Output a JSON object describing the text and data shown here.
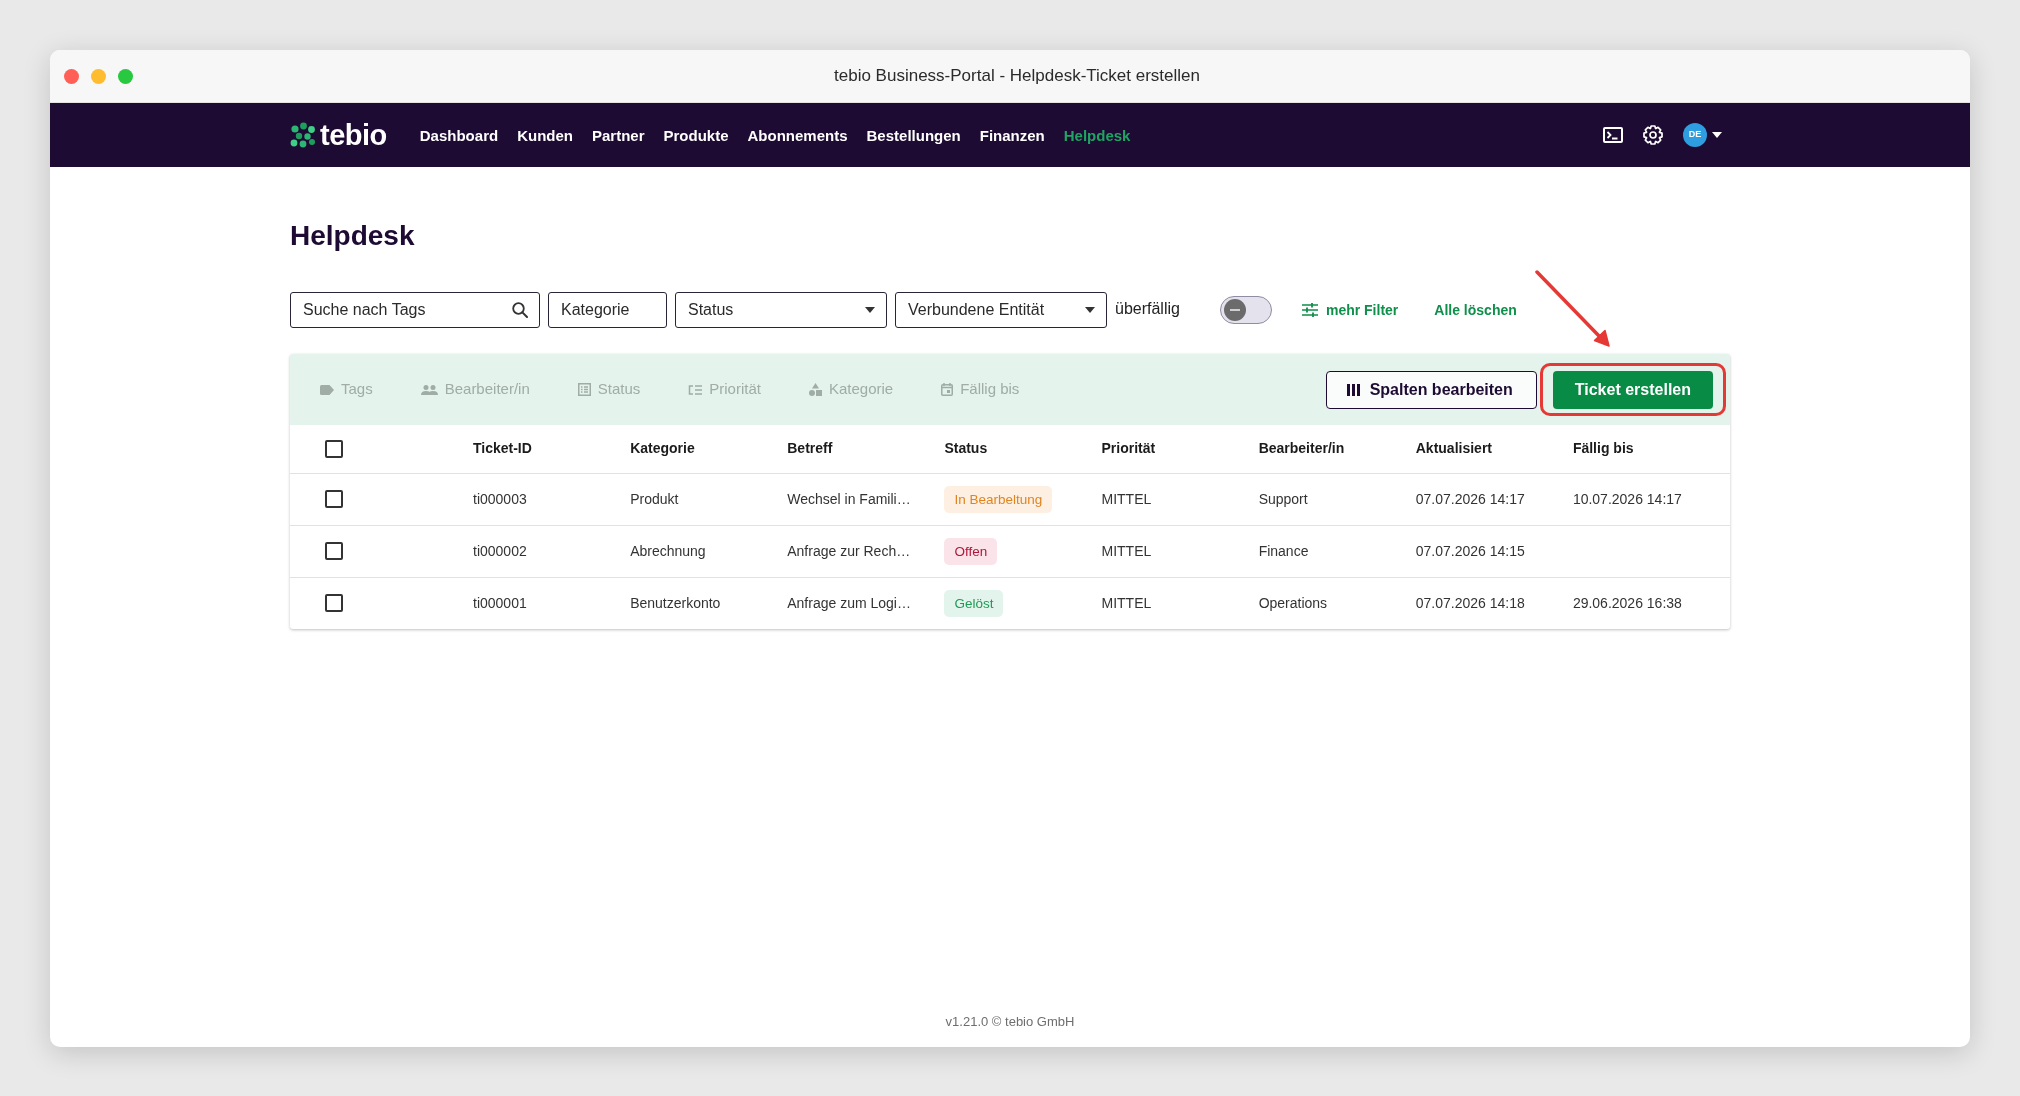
{
  "window": {
    "title": "tebio Business-Portal - Helpdesk-Ticket erstellen"
  },
  "navbar": {
    "brand": "tebio",
    "items": [
      {
        "label": "Dashboard",
        "selected": false
      },
      {
        "label": "Kunden",
        "selected": false
      },
      {
        "label": "Partner",
        "selected": false
      },
      {
        "label": "Produkte",
        "selected": false
      },
      {
        "label": "Abonnements",
        "selected": false
      },
      {
        "label": "Bestellungen",
        "selected": false
      },
      {
        "label": "Finanzen",
        "selected": false
      },
      {
        "label": "Helpdesk",
        "selected": true
      }
    ],
    "user": {
      "initials": "DE"
    }
  },
  "page": {
    "title": "Helpdesk"
  },
  "filters": {
    "fields": [
      {
        "kind": "search",
        "placeholder": "Suche nach Tags"
      },
      {
        "kind": "text",
        "placeholder": "Kategorie"
      },
      {
        "kind": "select",
        "placeholder": "Status"
      },
      {
        "kind": "select",
        "placeholder": "Verbundene Entität"
      }
    ],
    "overdue": {
      "label": "überfällig",
      "on": false
    },
    "more_filters": "mehr Filter",
    "clear_all": "Alle löschen"
  },
  "toolbar": {
    "column_chips": [
      {
        "label": "Tags"
      },
      {
        "label": "Bearbeiter/in"
      },
      {
        "label": "Status"
      },
      {
        "label": "Priorität"
      },
      {
        "label": "Kategorie"
      },
      {
        "label": "Fällig bis"
      }
    ],
    "edit_columns_button": "Spalten bearbeiten",
    "create_button": {
      "label": "Ticket erstellen",
      "highlighted": true
    }
  },
  "table": {
    "select_all": {
      "checked": false
    },
    "columns": [
      "Ticket-ID",
      "Kategorie",
      "Betreff",
      "Status",
      "Priorität",
      "Bearbeiter/in",
      "Aktualisiert",
      "Fällig bis"
    ],
    "rows": [
      {
        "checked": false,
        "ticket_id": "ti000003",
        "category": "Produkt",
        "subject": "Wechsel in Famili…",
        "status": {
          "label": "In Bearbeltung",
          "kind": "in_progress"
        },
        "priority": "MITTEL",
        "assignee": "Support",
        "updated": "07.07.2026 14:17",
        "due": "10.07.2026 14:17"
      },
      {
        "checked": false,
        "ticket_id": "ti000002",
        "category": "Abrechnung",
        "subject": "Anfrage zur Rech…",
        "status": {
          "label": "Offen",
          "kind": "open"
        },
        "priority": "MITTEL",
        "assignee": "Finance",
        "updated": "07.07.2026 14:15"
      },
      {
        "checked": false,
        "ticket_id": "ti000001",
        "category": "Benutzerkonto",
        "subject": "Anfrage zum Logi…",
        "status": {
          "label": "Gelöst",
          "kind": "resolved"
        },
        "priority": "MITTEL",
        "assignee": "Operations",
        "updated": "07.07.2026 14:18",
        "due": "29.06.2026 16:38"
      }
    ]
  },
  "footer": "v1.21.0 © tebio GmbH"
}
